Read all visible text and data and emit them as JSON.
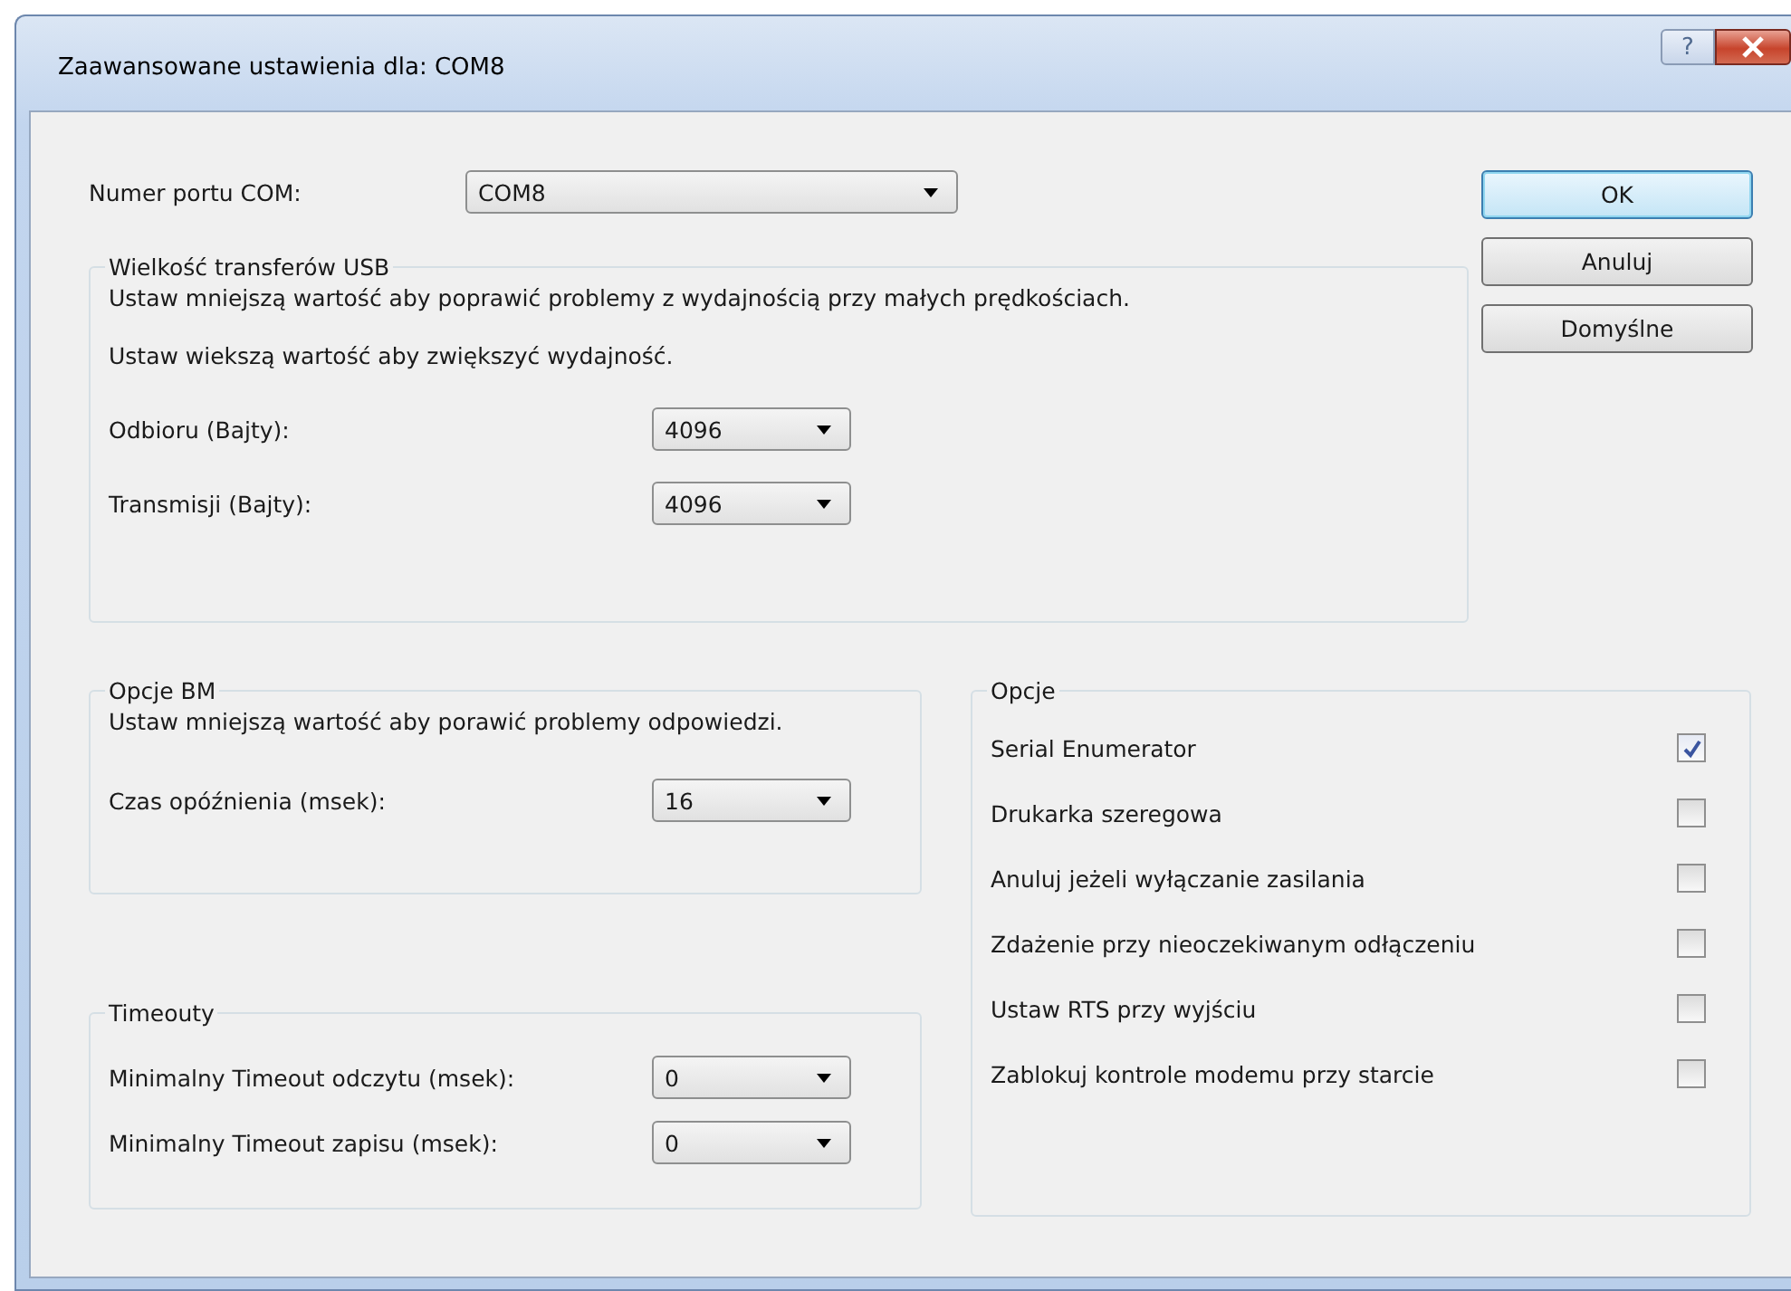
{
  "window": {
    "title": "Zaawansowane ustawienia dla: COM8",
    "help_button": "?"
  },
  "com_port": {
    "label": "Numer portu COM:",
    "value": "COM8"
  },
  "buttons": [
    {
      "label": "OK",
      "default": true
    },
    {
      "label": "Anuluj",
      "default": false
    },
    {
      "label": "Domyślne",
      "default": false
    }
  ],
  "usb_transfer": {
    "title": "Wielkość transferów USB",
    "notes": [
      "Ustaw mniejszą wartość aby poprawić problemy z wydajnością przy małych prędkościach.",
      "Ustaw wiekszą wartość aby zwiększyć wydajność."
    ],
    "fields": [
      {
        "label": "Odbioru (Bajty):",
        "value": "4096"
      },
      {
        "label": "Transmisji (Bajty):",
        "value": "4096"
      }
    ]
  },
  "bm_options": {
    "title": "Opcje BM",
    "notes": [
      "Ustaw mniejszą wartość aby porawić problemy odpowiedzi."
    ],
    "fields": [
      {
        "label": "Czas opóźnienia (msek):",
        "value": "16"
      }
    ]
  },
  "timeouts": {
    "title": "Timeouty",
    "fields": [
      {
        "label": "Minimalny Timeout odczytu (msek):",
        "value": "0"
      },
      {
        "label": "Minimalny Timeout zapisu (msek):",
        "value": "0"
      }
    ]
  },
  "options": {
    "title": "Opcje",
    "items": [
      {
        "label": "Serial Enumerator",
        "checked": true
      },
      {
        "label": "Drukarka szeregowa",
        "checked": false
      },
      {
        "label": "Anuluj jeżeli wyłączanie zasilania",
        "checked": false
      },
      {
        "label": "Zdażenie przy nieoczekiwanym odłączeniu",
        "checked": false
      },
      {
        "label": "Ustaw RTS przy wyjściu",
        "checked": false
      },
      {
        "label": "Zablokuj kontrole modemu przy starcie",
        "checked": false
      }
    ]
  }
}
